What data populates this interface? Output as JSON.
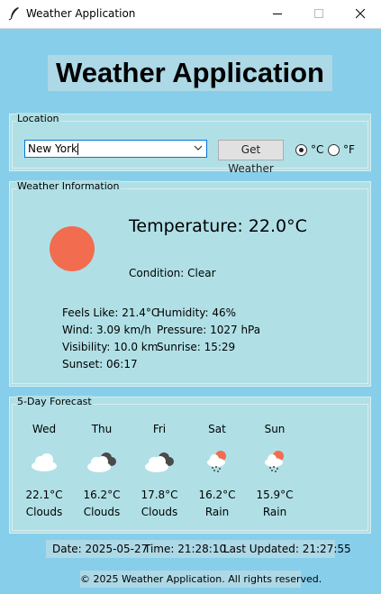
{
  "window": {
    "title": "Weather Application"
  },
  "main_title": "Weather Application",
  "location": {
    "legend": "Location",
    "city_value": "New York",
    "get_button": "Get Weather",
    "unit_c": "°C",
    "unit_f": "°F",
    "selected_unit": "C"
  },
  "info": {
    "legend": "Weather Information",
    "temperature": "Temperature: 22.0°C",
    "condition": "Condition: Clear",
    "feels_like": "Feels Like: 21.4°C",
    "humidity": "Humidity: 46%",
    "wind": "Wind: 3.09 km/h",
    "pressure": "Pressure: 1027 hPa",
    "visibility": "Visibility: 10.0 km",
    "sunrise": "Sunrise: 15:29",
    "sunset": "Sunset: 06:17",
    "sun_color": "#f26c4f"
  },
  "forecast": {
    "legend": "5-Day Forecast",
    "days": [
      {
        "day": "Wed",
        "temp": "22.1°C",
        "cond": "Clouds",
        "icon": "cloud-icon"
      },
      {
        "day": "Thu",
        "temp": "16.2°C",
        "cond": "Clouds",
        "icon": "dark-clouds-icon"
      },
      {
        "day": "Fri",
        "temp": "17.8°C",
        "cond": "Clouds",
        "icon": "dark-clouds-icon"
      },
      {
        "day": "Sat",
        "temp": "16.2°C",
        "cond": "Rain",
        "icon": "rain-sun-icon"
      },
      {
        "day": "Sun",
        "temp": "15.9°C",
        "cond": "Rain",
        "icon": "rain-sun-icon"
      }
    ]
  },
  "status": {
    "date": "Date: 2025-05-27",
    "time": "Time: 21:28:10",
    "updated": "Last Updated: 21:27:55"
  },
  "footer": "© 2025 Weather Application. All rights reserved.",
  "colors": {
    "background": "#87ceeb",
    "panel": "#b0e0e6",
    "label_bg": "#add8e6"
  }
}
